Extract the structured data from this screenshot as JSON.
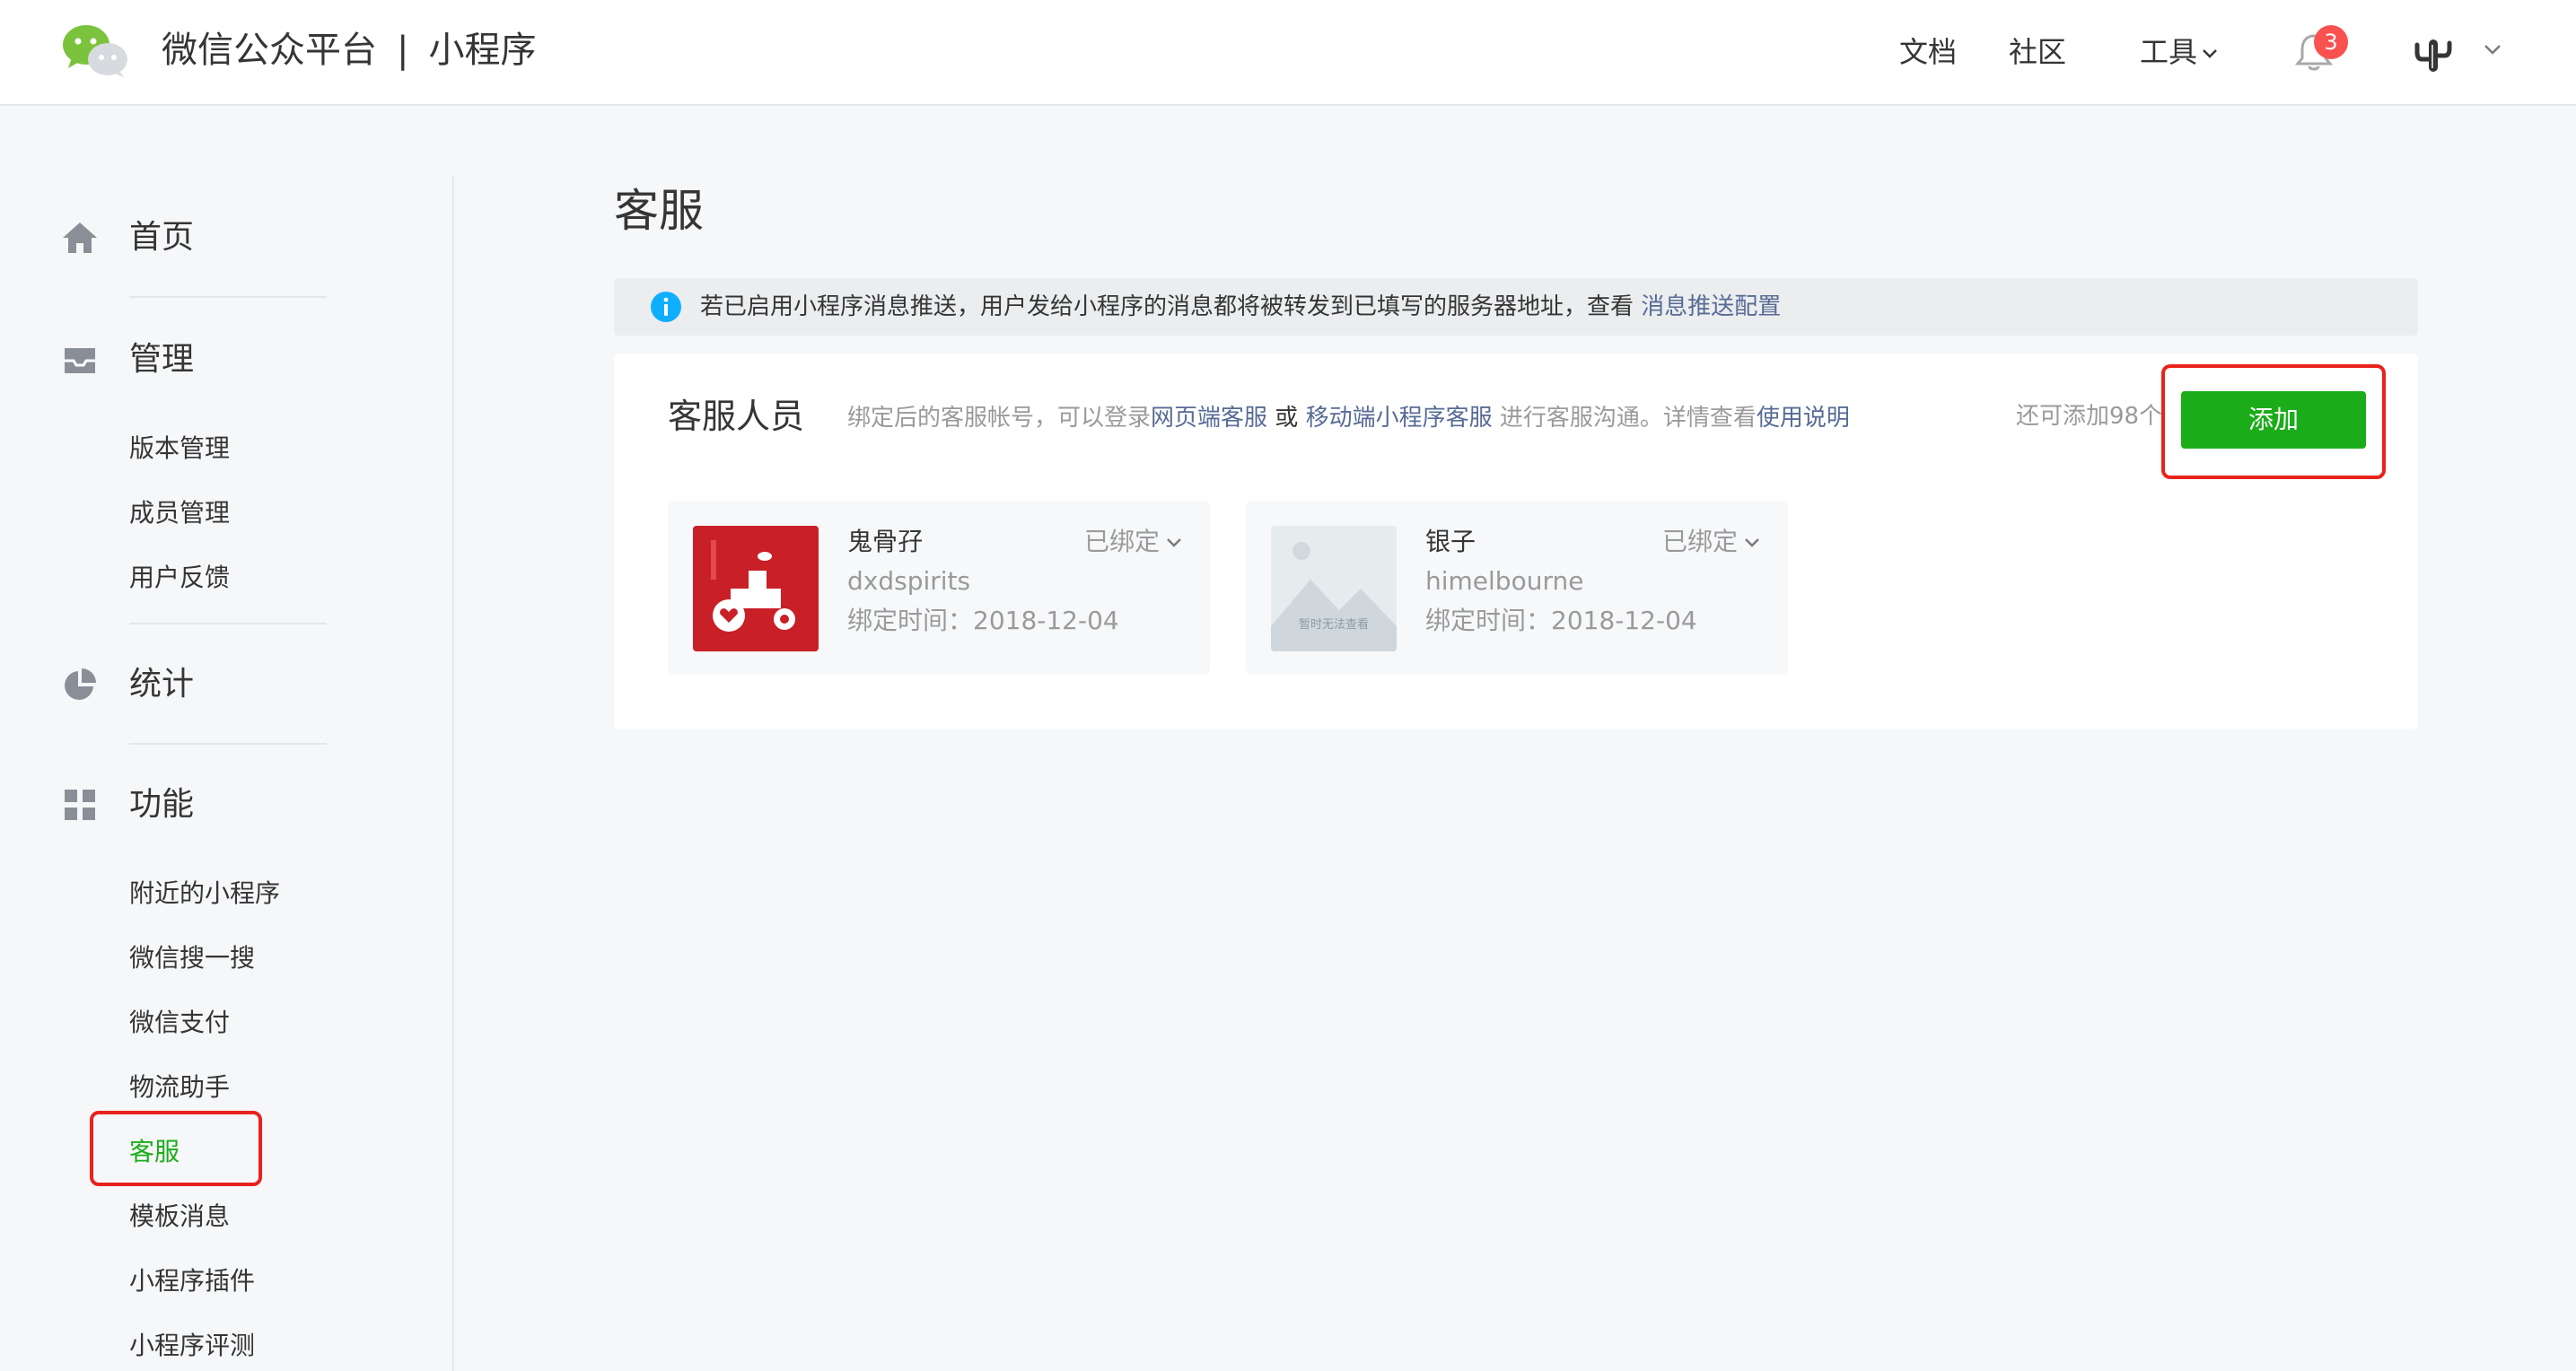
{
  "header": {
    "brand": "微信公众平台",
    "separator": "|",
    "product": "小程序",
    "nav": {
      "docs": "文档",
      "community": "社区",
      "tools": "工具"
    },
    "notification_count": "3"
  },
  "sidebar": {
    "groups": [
      {
        "label": "首页",
        "icon": "home-icon"
      },
      {
        "label": "管理",
        "icon": "inbox-icon"
      },
      {
        "label": "统计",
        "icon": "pie-chart-icon"
      },
      {
        "label": "功能",
        "icon": "grid-icon"
      }
    ],
    "manage_items": [
      "版本管理",
      "成员管理",
      "用户反馈"
    ],
    "feature_items": [
      "附近的小程序",
      "微信搜一搜",
      "微信支付",
      "物流助手",
      "客服",
      "模板消息",
      "小程序插件",
      "小程序评测"
    ],
    "active_item": "客服"
  },
  "main": {
    "title": "客服",
    "notice": {
      "text": "若已启用小程序消息推送，用户发给小程序的消息都将被转发到已填写的服务器地址，查看",
      "link": "消息推送配置"
    },
    "panel": {
      "title": "客服人员",
      "desc_prefix": "绑定后的客服帐号，可以登录",
      "desc_link1": "网页端客服",
      "desc_or": "或",
      "desc_link2": "移动端小程序客服",
      "desc_middle": "进行客服沟通。详情查看",
      "desc_link3": "使用说明",
      "remaining": "还可添加98个",
      "add_button": "添加"
    },
    "agents": [
      {
        "name": "鬼骨孖",
        "wxid": "dxdspirits",
        "bind_time": "绑定时间：2018-12-04",
        "status": "已绑定"
      },
      {
        "name": "银子",
        "wxid": "himelbourne",
        "bind_time": "绑定时间：2018-12-04",
        "status": "已绑定",
        "avatar_text": "暂时无法查看"
      }
    ]
  },
  "colors": {
    "accent_green": "#1aad19",
    "link_blue": "#576b95",
    "highlight_red": "#e8231c",
    "badge_red": "#fa5151",
    "info_blue": "#10aeff"
  }
}
